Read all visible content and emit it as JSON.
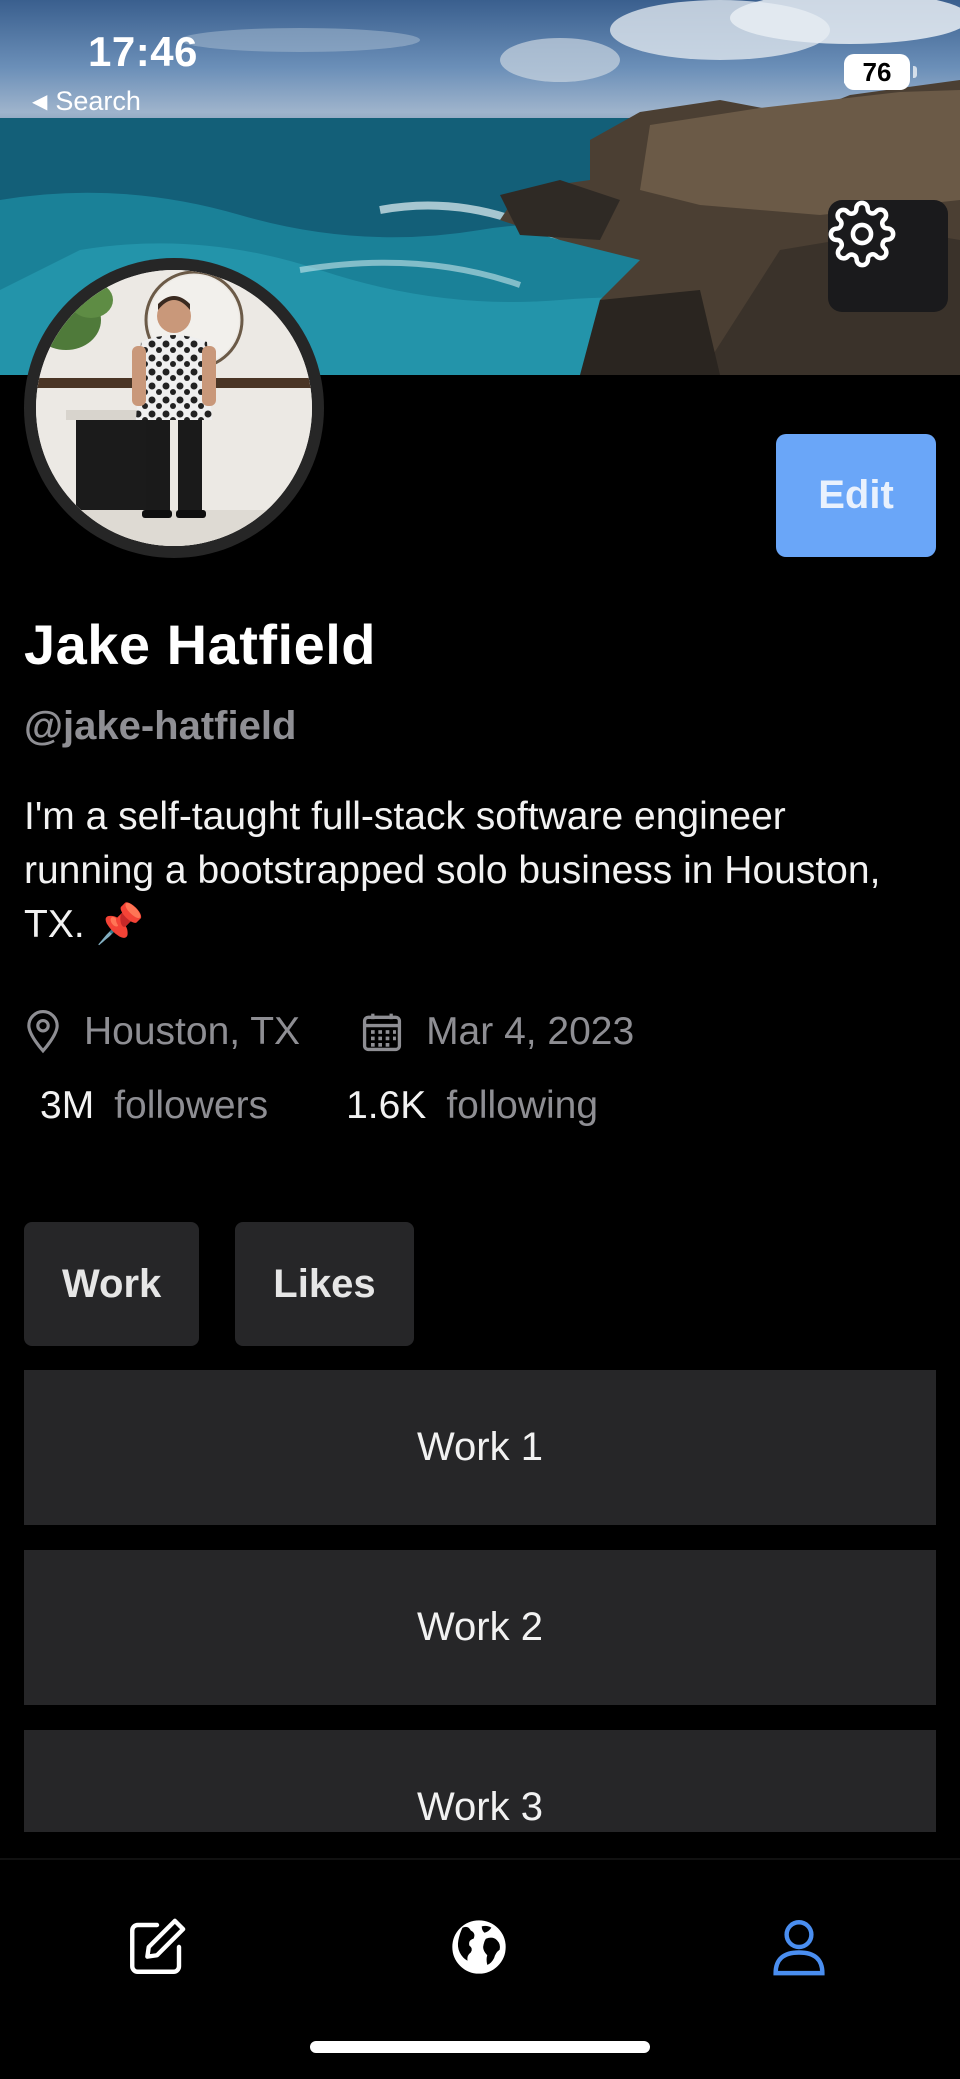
{
  "status_bar": {
    "time": "17:46",
    "back_label": "Search",
    "battery": "76"
  },
  "profile": {
    "name": "Jake Hatfield",
    "handle": "@jake-hatfield",
    "bio": "I'm a self-taught full-stack software engineer running a bootstrapped solo business in Houston, TX. 📌",
    "location": "Houston, TX",
    "joined": "Mar 4, 2023",
    "followers_count": "3M",
    "followers_label": "followers",
    "following_count": "1.6K",
    "following_label": "following",
    "edit_label": "Edit"
  },
  "tabs": [
    {
      "label": "Work"
    },
    {
      "label": "Likes"
    }
  ],
  "works": [
    {
      "label": "Work 1"
    },
    {
      "label": "Work 2"
    },
    {
      "label": "Work 3"
    }
  ],
  "tab_bar": {
    "items": [
      {
        "icon": "compose-icon",
        "active": false
      },
      {
        "icon": "globe-icon",
        "active": false
      },
      {
        "icon": "profile-icon",
        "active": true
      }
    ],
    "accent": "#4a8ef0"
  },
  "colors": {
    "edit_button": "#6aa6f8",
    "card": "#262628",
    "muted_text": "#8e8e93"
  }
}
